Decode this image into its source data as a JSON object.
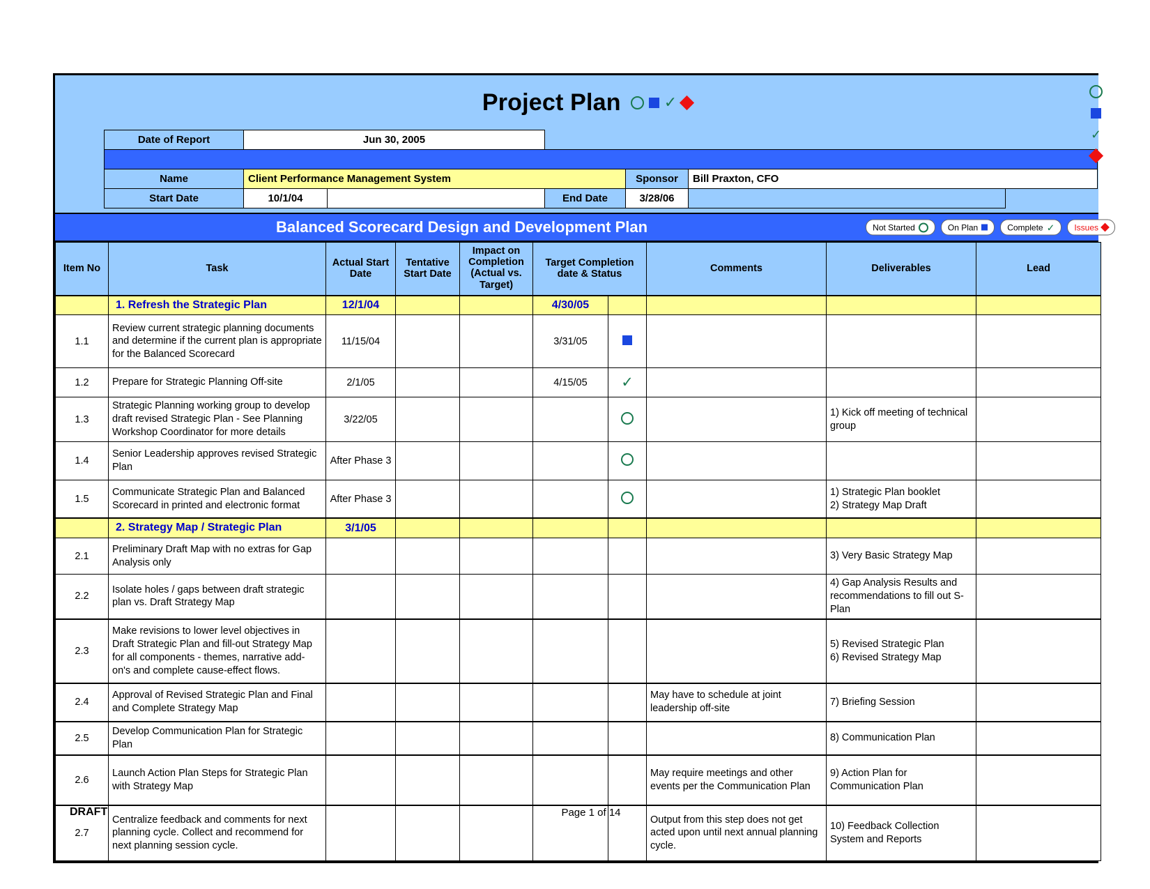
{
  "header": {
    "title": "Project Plan",
    "legend_glyphs": [
      "not-started-circle",
      "on-plan-square",
      "complete-check",
      "issues-diamond"
    ],
    "date_of_report_label": "Date of Report",
    "date_of_report_value": "Jun 30, 2005",
    "name_label": "Name",
    "name_value": "Client Performance Management System",
    "sponsor_label": "Sponsor",
    "sponsor_value": "Bill Praxton, CFO",
    "start_date_label": "Start Date",
    "start_date_value": "10/1/04",
    "end_date_label": "End Date",
    "end_date_value": "3/28/06"
  },
  "banner": {
    "title": "Balanced Scorecard Design and Development Plan",
    "legend": [
      {
        "label": "Not Started",
        "glyph": "circle",
        "color": "#1a7a4f"
      },
      {
        "label": "On Plan",
        "glyph": "square",
        "color": "#1a47e0"
      },
      {
        "label": "Complete",
        "glyph": "check",
        "color": "#1a7a4f"
      },
      {
        "label": "Issues",
        "glyph": "diamond",
        "color": "#ee1111"
      }
    ]
  },
  "columns": {
    "item_no": "Item No",
    "task": "Task",
    "actual_start": "Actual Start Date",
    "tentative_start": "Tentative Start Date",
    "impact": "Impact on Completion (Actual vs. Target)",
    "target": "Target Completion date & Status",
    "status": "",
    "comments": "Comments",
    "deliverables": "Deliverables",
    "lead": "Lead"
  },
  "rows": [
    {
      "type": "section",
      "item": "",
      "task": "1. Refresh the Strategic Plan",
      "actual": "12/1/04",
      "tentative": "",
      "impact": "",
      "target": "4/30/05",
      "status": "",
      "comments": "",
      "deliverables": "",
      "lead": ""
    },
    {
      "type": "task",
      "item": "1.1",
      "task": "Review current strategic planning documents and determine if the current plan is appropriate for the Balanced Scorecard",
      "actual": "11/15/04",
      "tentative": "",
      "impact": "",
      "target": "3/31/05",
      "status": "square",
      "comments": "",
      "deliverables": "",
      "lead": ""
    },
    {
      "type": "task",
      "item": "1.2",
      "task": "Prepare for Strategic Planning Off-site",
      "actual": "2/1/05",
      "tentative": "",
      "impact": "",
      "target": "4/15/05",
      "status": "check",
      "comments": "",
      "deliverables": "",
      "lead": ""
    },
    {
      "type": "task",
      "item": "1.3",
      "task": "Strategic Planning working group to develop draft revised Strategic Plan - See Planning Workshop Coordinator for more details",
      "actual": "3/22/05",
      "tentative": "",
      "impact": "",
      "target": "",
      "status": "circle",
      "comments": "",
      "deliverables": "1) Kick off meeting of technical group",
      "lead": ""
    },
    {
      "type": "task",
      "item": "1.4",
      "task": "Senior Leadership approves revised Strategic Plan",
      "actual": "After Phase 3",
      "tentative": "",
      "impact": "",
      "target": "",
      "status": "circle",
      "comments": "",
      "deliverables": "",
      "lead": ""
    },
    {
      "type": "task",
      "item": "1.5",
      "task": "Communicate Strategic Plan and Balanced Scorecard in printed and electronic format",
      "actual": "After Phase 3",
      "tentative": "",
      "impact": "",
      "target": "",
      "status": "circle",
      "comments": "",
      "deliverables": "1) Strategic Plan booklet\n2) Strategy Map Draft",
      "lead": ""
    },
    {
      "type": "section",
      "item": "",
      "task": "2. Strategy Map / Strategic Plan",
      "actual": "3/1/05",
      "tentative": "",
      "impact": "",
      "target": "",
      "status": "",
      "comments": "",
      "deliverables": "",
      "lead": ""
    },
    {
      "type": "task",
      "item": "2.1",
      "task": "Preliminary Draft Map with no extras for Gap Analysis only",
      "actual": "",
      "tentative": "",
      "impact": "",
      "target": "",
      "status": "",
      "comments": "",
      "deliverables": "3) Very Basic Strategy Map",
      "lead": ""
    },
    {
      "type": "task",
      "item": "2.2",
      "task": "Isolate holes / gaps between draft strategic plan vs. Draft Strategy Map",
      "actual": "",
      "tentative": "",
      "impact": "",
      "target": "",
      "status": "",
      "comments": "",
      "deliverables": "4) Gap Analysis Results and recommendations to fill out S-Plan",
      "lead": ""
    },
    {
      "type": "task",
      "item": "2.3",
      "task": "Make revisions to lower level objectives in Draft Strategic Plan and fill-out Strategy Map for all components - themes, narrative add-on's and complete cause-effect flows.",
      "actual": "",
      "tentative": "",
      "impact": "",
      "target": "",
      "status": "",
      "comments": "",
      "deliverables": "5) Revised Strategic Plan\n6) Revised Strategy Map",
      "lead": ""
    },
    {
      "type": "task",
      "item": "2.4",
      "task": "Approval of Revised Strategic Plan and Final and Complete Strategy Map",
      "actual": "",
      "tentative": "",
      "impact": "",
      "target": "",
      "status": "",
      "comments": "May have to schedule at joint leadership off-site",
      "deliverables": "7) Briefing Session",
      "lead": ""
    },
    {
      "type": "task",
      "item": "2.5",
      "task": "Develop Communication Plan for Strategic Plan",
      "actual": "",
      "tentative": "",
      "impact": "",
      "target": "",
      "status": "",
      "comments": "",
      "deliverables": "8) Communication Plan",
      "lead": ""
    },
    {
      "type": "task",
      "item": "2.6",
      "task": "Launch Action Plan Steps for Strategic Plan with Strategy Map",
      "actual": "",
      "tentative": "",
      "impact": "",
      "target": "",
      "status": "",
      "comments": "May require meetings and other events per the Communication Plan",
      "deliverables": "9) Action Plan for Communication Plan",
      "lead": ""
    },
    {
      "type": "task",
      "item": "2.7",
      "task": "Centralize feedback and comments for next planning cycle. Collect and recommend for next planning session cycle.",
      "actual": "",
      "tentative": "",
      "impact": "",
      "target": "",
      "status": "",
      "comments": "Output from this step does not get acted upon until next annual planning cycle.",
      "deliverables": "10) Feedback Collection System and Reports",
      "lead": ""
    }
  ],
  "footer": {
    "draft": "DRAFT",
    "page": "Page 1 of 14"
  },
  "colors": {
    "header_blue": "#99ccff",
    "banner_blue": "#3366ff",
    "section_yellow": "#ffff99",
    "section_text": "#0000cc",
    "status_green": "#1a7a4f",
    "status_blue": "#1a47e0",
    "status_red": "#ee1111"
  }
}
